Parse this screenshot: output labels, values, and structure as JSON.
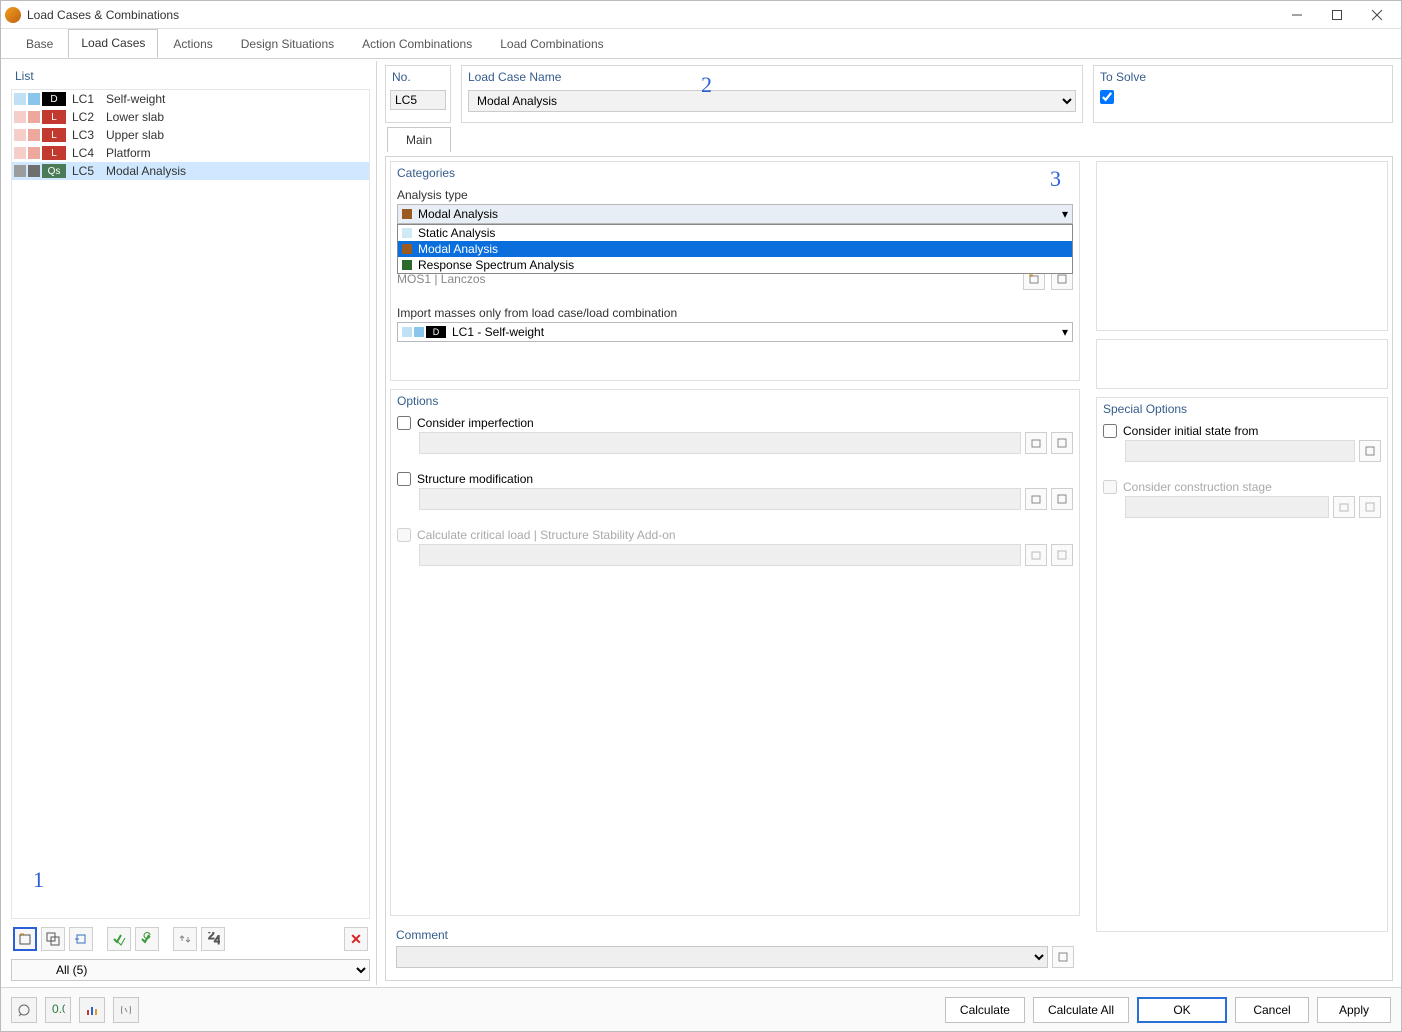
{
  "window": {
    "title": "Load Cases & Combinations"
  },
  "tabs": {
    "base": "Base",
    "load_cases": "Load Cases",
    "actions": "Actions",
    "design_situations": "Design Situations",
    "action_combinations": "Action Combinations",
    "load_combinations": "Load Combinations"
  },
  "left": {
    "title": "List",
    "items": [
      {
        "code": "LC1",
        "name": "Self-weight",
        "badge": "D",
        "badge_bg": "#000000",
        "sw_a": "#bfe0f5",
        "sw_b": "#8ac6ec",
        "selected": false
      },
      {
        "code": "LC2",
        "name": "Lower slab",
        "badge": "L",
        "badge_bg": "#c23a2f",
        "sw_a": "#f5ceca",
        "sw_b": "#eea79d",
        "selected": false
      },
      {
        "code": "LC3",
        "name": "Upper slab",
        "badge": "L",
        "badge_bg": "#c23a2f",
        "sw_a": "#f5ceca",
        "sw_b": "#eea79d",
        "selected": false
      },
      {
        "code": "LC4",
        "name": "Platform",
        "badge": "L",
        "badge_bg": "#c23a2f",
        "sw_a": "#f5ceca",
        "sw_b": "#eea79d",
        "selected": false
      },
      {
        "code": "LC5",
        "name": "Modal Analysis",
        "badge": "Qs",
        "badge_bg": "#4a7a56",
        "sw_a": "#9c9c9c",
        "sw_b": "#6f6f6f",
        "selected": true
      }
    ],
    "filter": "All (5)"
  },
  "header": {
    "no_label": "No.",
    "no_value": "LC5",
    "name_label": "Load Case Name",
    "name_value": "Modal Analysis",
    "solve_label": "To Solve"
  },
  "subtab": {
    "main": "Main"
  },
  "categories": {
    "title": "Categories",
    "analysis_label": "Analysis type",
    "selected": "Modal Analysis",
    "options": {
      "static": "Static Analysis",
      "modal": "Modal Analysis",
      "rsa": "Response Spectrum Analysis"
    },
    "mos_line": "MOS1     | Lanczos",
    "import_label": "Import masses only from load case/load combination",
    "import_value": "LC1 - Self-weight"
  },
  "options": {
    "title": "Options",
    "imperfection": "Consider imperfection",
    "structure": "Structure modification",
    "critical": "Calculate critical load | Structure Stability Add-on"
  },
  "special": {
    "title": "Special Options",
    "initial": "Consider initial state from",
    "construction": "Consider construction stage"
  },
  "comment": {
    "title": "Comment"
  },
  "footer": {
    "calculate": "Calculate",
    "calculate_all": "Calculate All",
    "ok": "OK",
    "cancel": "Cancel",
    "apply": "Apply"
  },
  "annot": {
    "n1": "1",
    "n2": "2",
    "n3": "3"
  }
}
